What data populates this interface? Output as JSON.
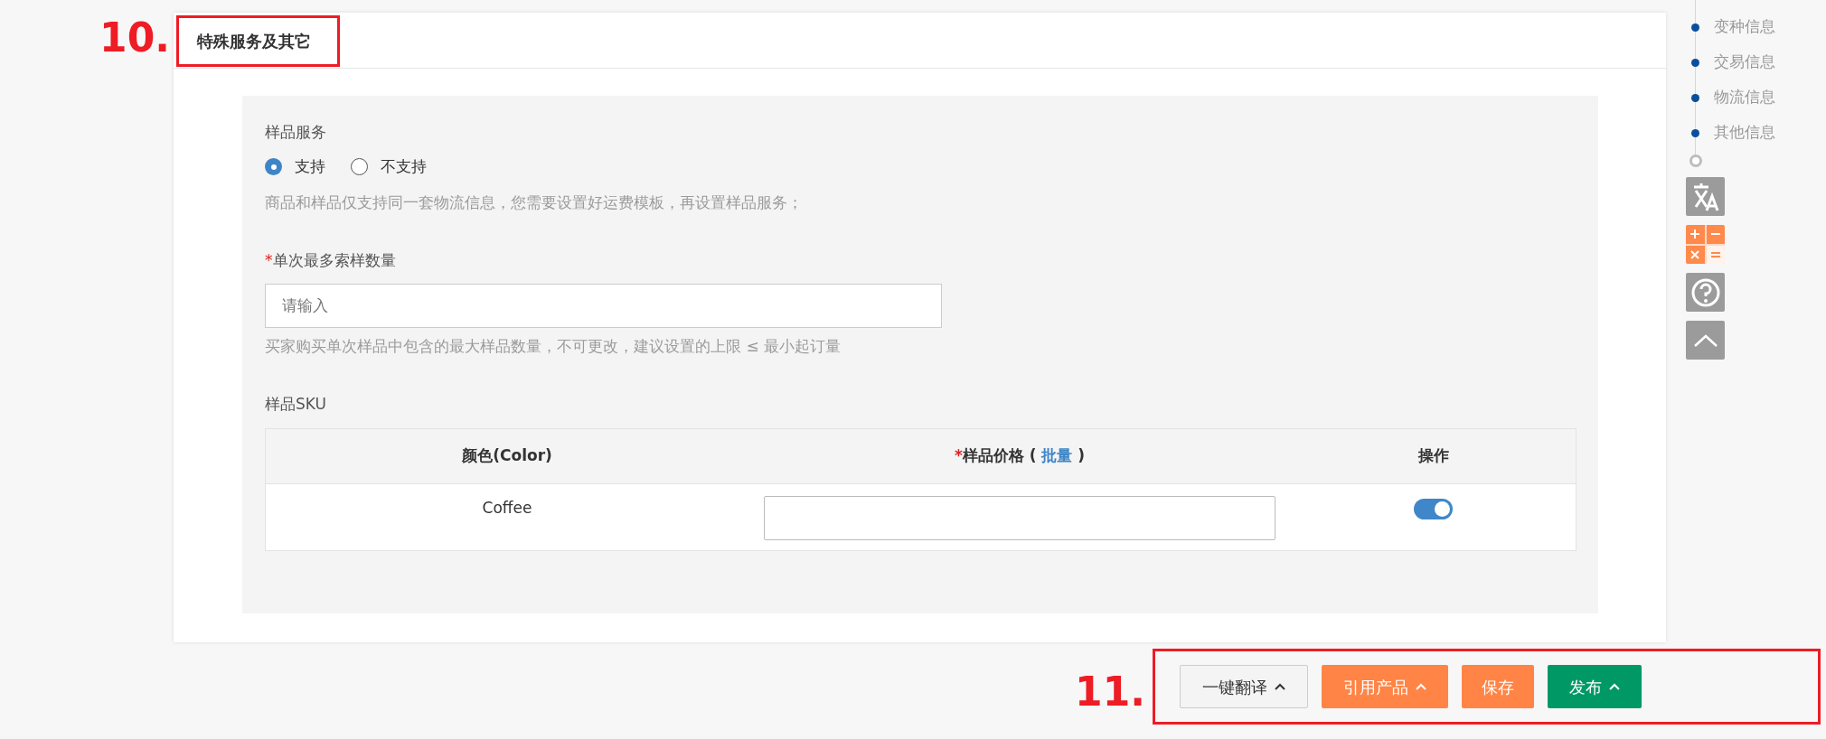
{
  "annotations": [
    {
      "label": "10."
    },
    {
      "label": "11."
    }
  ],
  "section": {
    "title": "特殊服务及其它",
    "sample_service": {
      "label": "样品服务",
      "options": [
        {
          "label": "支持",
          "selected": true
        },
        {
          "label": "不支持",
          "selected": false
        }
      ],
      "hint": "商品和样品仅支持同一套物流信息，您需要设置好运费模板，再设置样品服务；"
    },
    "max_quantity": {
      "label": "单次最多索样数量",
      "required_mark": "*",
      "placeholder": "请输入",
      "hint": "买家购买单次样品中包含的最大样品数量，不可更改，建议设置的上限 ≤ 最小起订量"
    },
    "sku": {
      "label": "样品SKU",
      "columns": [
        {
          "label": "颜色(Color)"
        },
        {
          "label": "样品价格 (",
          "link": "批量",
          "suffix": ")",
          "required_mark": "*"
        },
        {
          "label": "操作"
        }
      ],
      "rows": [
        {
          "name": "Coffee",
          "on": true
        }
      ]
    }
  },
  "nav": {
    "items": [
      {
        "label": "变种信息"
      },
      {
        "label": "交易信息"
      },
      {
        "label": "物流信息"
      },
      {
        "label": "其他信息"
      }
    ]
  },
  "actions": [
    {
      "label": "一键翻译",
      "kind": "secondary",
      "caret": true
    },
    {
      "label": "引用产品",
      "kind": "orange",
      "caret": true
    },
    {
      "label": "保存",
      "kind": "orange",
      "caret": false
    },
    {
      "label": "发布",
      "kind": "green",
      "caret": true
    }
  ]
}
